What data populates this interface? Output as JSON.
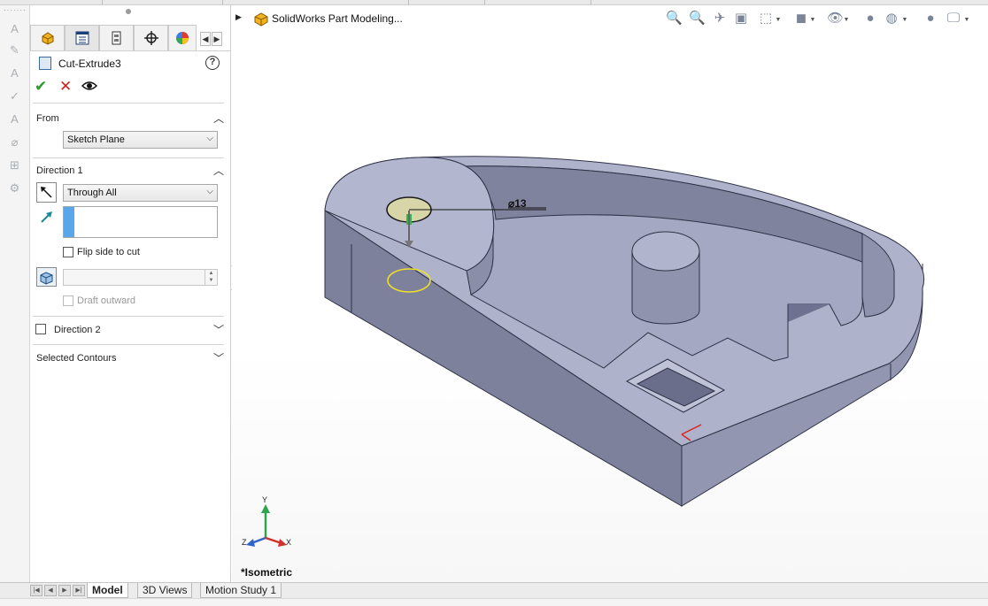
{
  "property_manager": {
    "tabs": [
      {
        "icon": "feature-manager-icon"
      },
      {
        "icon": "property-manager-icon"
      },
      {
        "icon": "configuration-manager-icon"
      },
      {
        "icon": "dim-xpert-icon"
      },
      {
        "icon": "display-manager-icon"
      }
    ],
    "title": "Cut-Extrude3",
    "help": "?",
    "actions": {
      "ok": "✔",
      "cancel": "✕"
    },
    "from": {
      "label": "From",
      "value": "Sketch Plane"
    },
    "direction1": {
      "label": "Direction 1",
      "end_condition": "Through All",
      "flip_side_label": "Flip side to cut",
      "draft_outward_label": "Draft outward"
    },
    "direction2": {
      "label": "Direction 2"
    },
    "selected_contours": {
      "label": "Selected Contours"
    }
  },
  "viewport": {
    "part_name": "SolidWorks Part Modeling...",
    "dimension": "⌀13",
    "view_label": "*Isometric",
    "triad": {
      "x": "X",
      "y": "Y",
      "z": "Z"
    },
    "colors": {
      "part_face": "#a3a7c2",
      "part_side": "#7c809c",
      "part_dark": "#5d6079",
      "sketch_fill": "#d8d6a8",
      "selection": "#f0e028"
    }
  },
  "bottom_tabs": [
    {
      "label": "Model"
    },
    {
      "label": "3D Views"
    },
    {
      "label": "Motion Study 1"
    }
  ]
}
